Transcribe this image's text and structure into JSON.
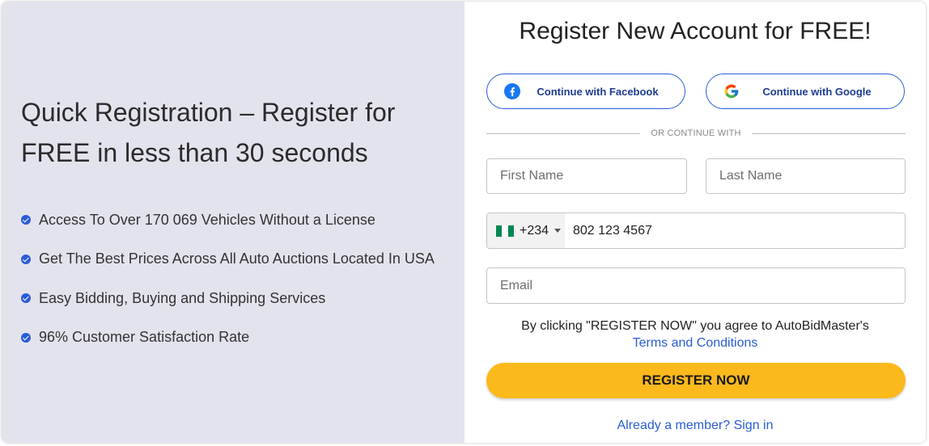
{
  "left": {
    "headline": "Quick Registration – Register for FREE in less than 30 seconds",
    "benefits": [
      "Access To Over 170 069 Vehicles Without a License",
      "Get The Best Prices Across All Auto Auctions Located In USA",
      "Easy Bidding, Buying and Shipping Services",
      "96% Customer Satisfaction Rate"
    ]
  },
  "form": {
    "title": "Register New Account for FREE!",
    "facebook_label": "Continue with Facebook",
    "google_label": "Continue with Google",
    "divider_text": "OR CONTINUE WITH",
    "first_name_placeholder": "First Name",
    "last_name_placeholder": "Last Name",
    "phone": {
      "country_code": "+234",
      "number": "802 123 4567"
    },
    "email_placeholder": "Email",
    "agreement_text": "By clicking \"REGISTER NOW\" you agree to AutoBidMaster's",
    "terms_link": "Terms and Conditions",
    "register_label": "REGISTER NOW",
    "signin_link": "Already a member? Sign in"
  },
  "colors": {
    "left_bg": "#e3e3ee",
    "accent_blue": "#2a5cd6",
    "register_yellow": "#fbb91c",
    "facebook_blue": "#1877f2",
    "flag_green": "#008751"
  },
  "icons": {
    "benefit": "check-circle-icon",
    "facebook": "facebook-icon",
    "google": "google-icon",
    "country_flag": "nigeria-flag-icon",
    "country_dropdown": "caret-down-icon"
  }
}
